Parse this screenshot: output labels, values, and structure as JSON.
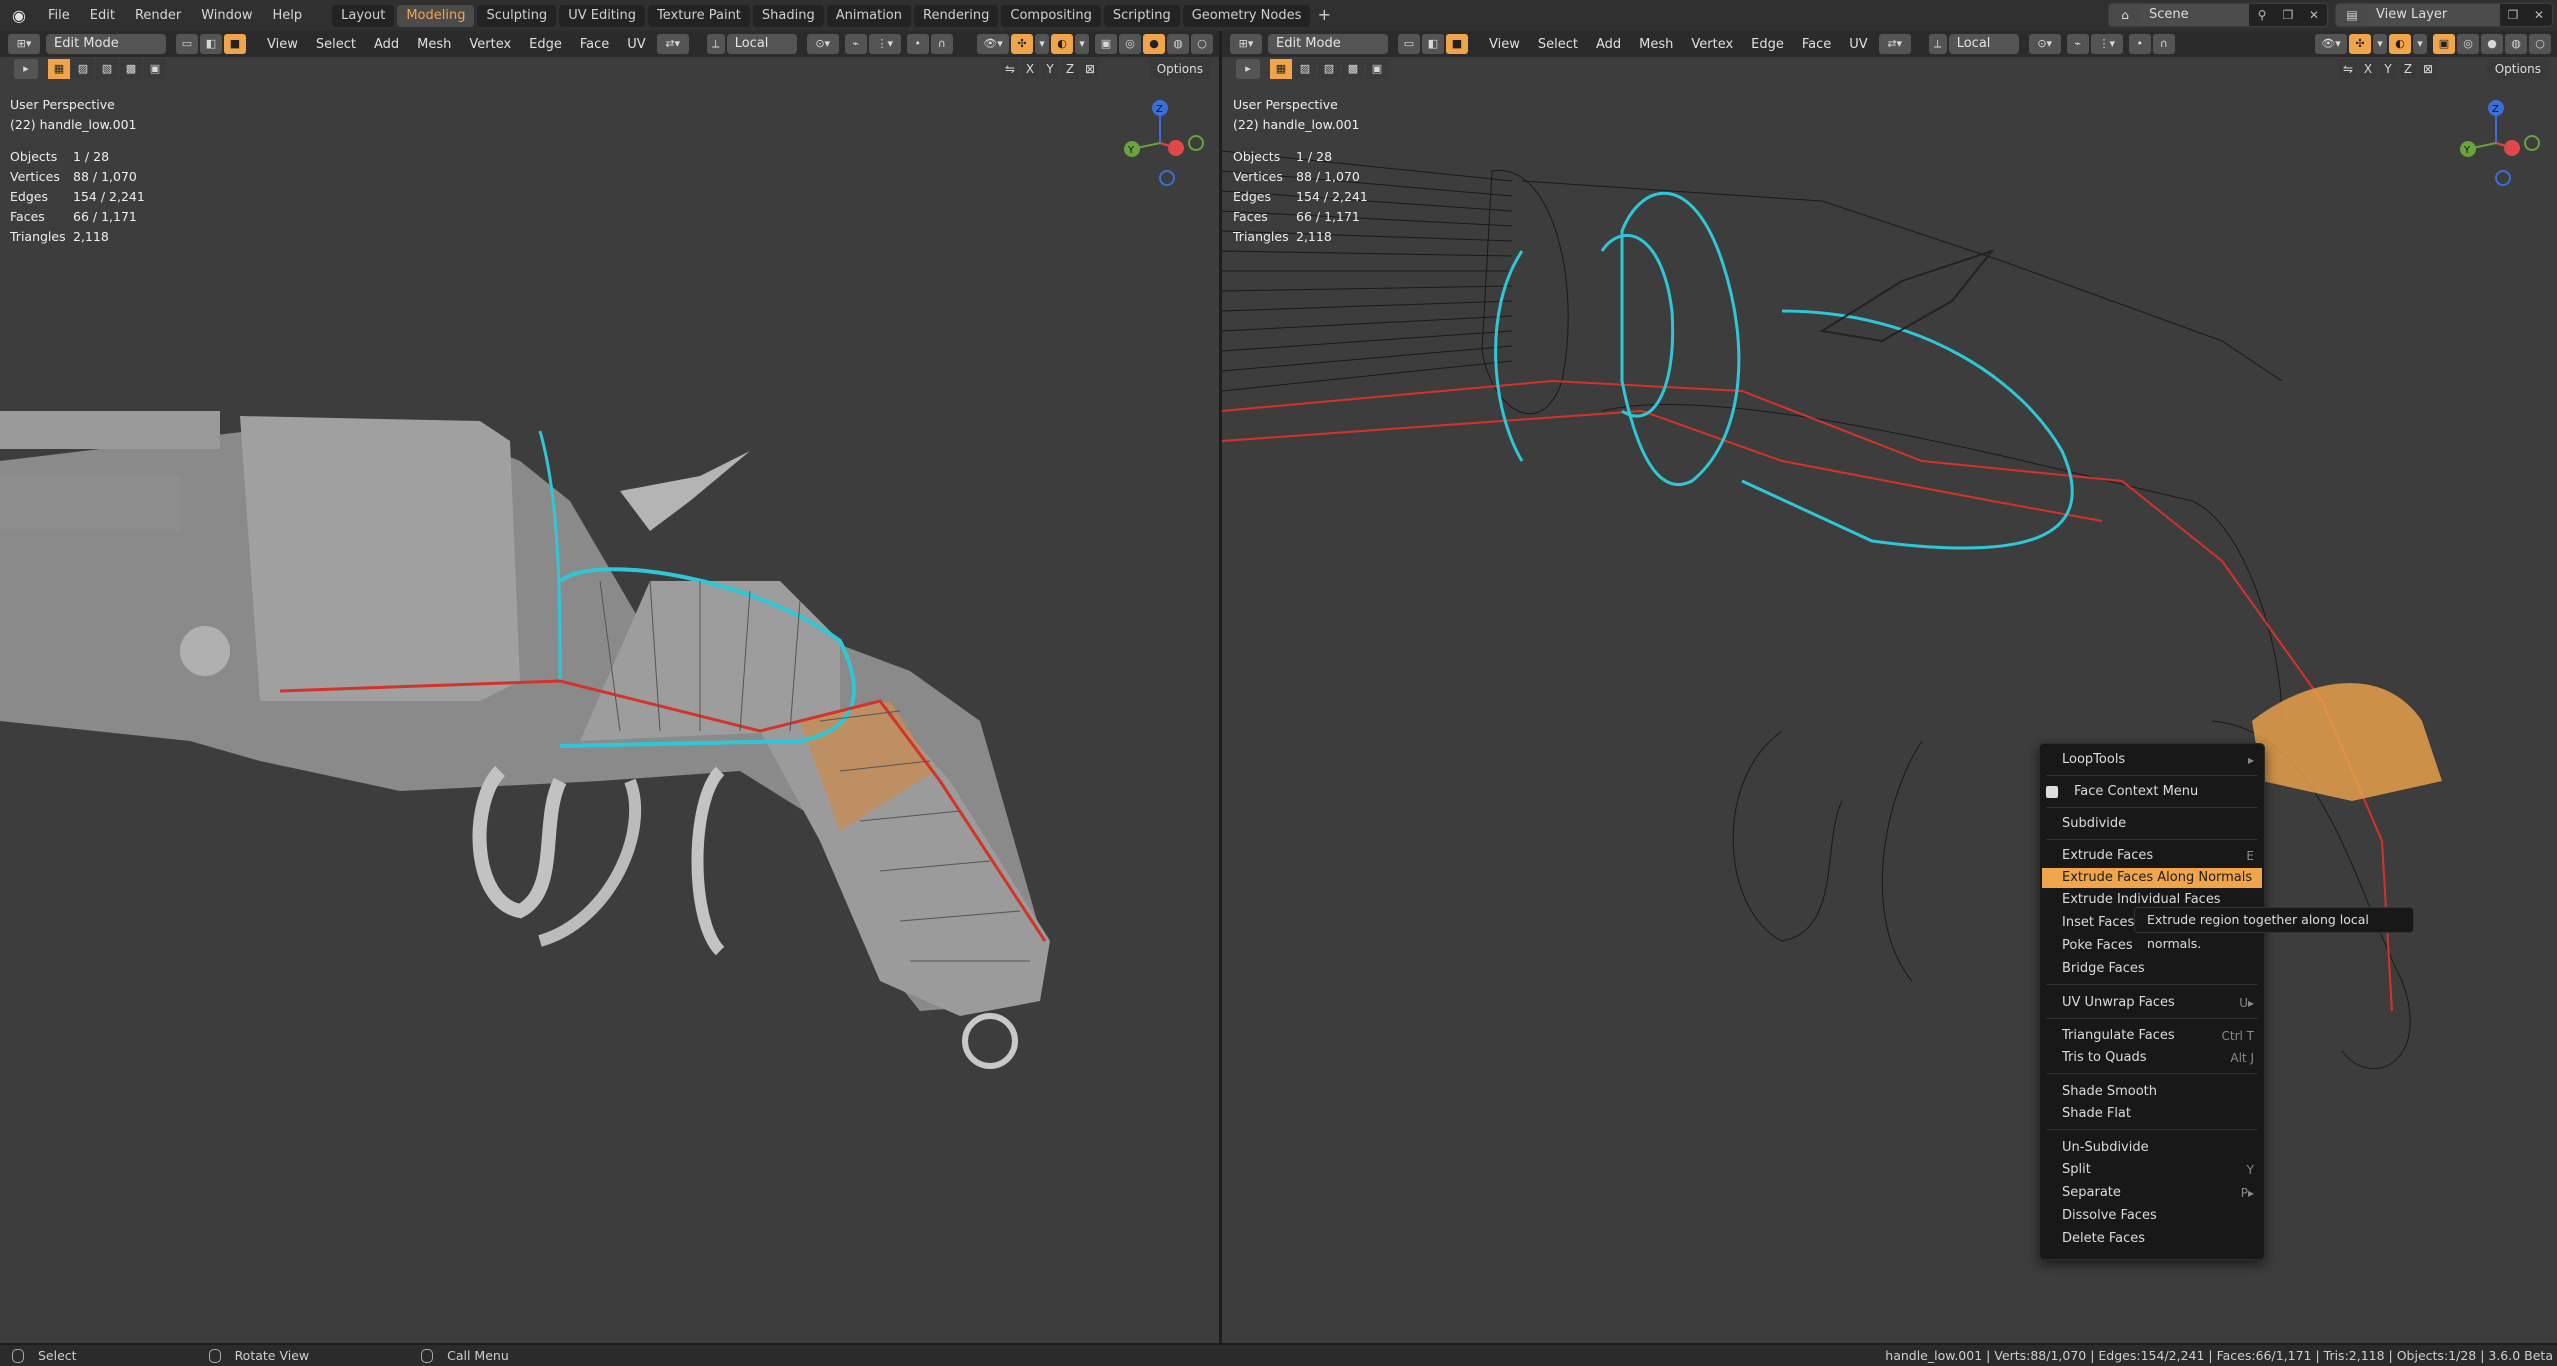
{
  "topbar": {
    "menu": [
      "File",
      "Edit",
      "Render",
      "Window",
      "Help"
    ],
    "workspaces": [
      "Layout",
      "Modeling",
      "Sculpting",
      "UV Editing",
      "Texture Paint",
      "Shading",
      "Animation",
      "Rendering",
      "Compositing",
      "Scripting",
      "Geometry Nodes"
    ],
    "active_workspace": "Modeling",
    "add_tab": "+",
    "scene": "Scene",
    "view_layer": "View Layer"
  },
  "viewport_left": {
    "mode": "Edit Mode",
    "menus": [
      "View",
      "Select",
      "Add",
      "Mesh",
      "Vertex",
      "Edge",
      "Face",
      "UV"
    ],
    "transform_orientation": "Local",
    "options": "Options",
    "axes": [
      "X",
      "Y",
      "Z"
    ],
    "view_name": "User Perspective",
    "object_name": "(22) handle_low.001",
    "stats": [
      {
        "label": "Objects",
        "value": "1 / 28"
      },
      {
        "label": "Vertices",
        "value": "88 / 1,070"
      },
      {
        "label": "Edges",
        "value": "154 / 2,241"
      },
      {
        "label": "Faces",
        "value": "66 / 1,171"
      },
      {
        "label": "Triangles",
        "value": "2,118"
      }
    ]
  },
  "viewport_right": {
    "mode": "Edit Mode",
    "menus": [
      "View",
      "Select",
      "Add",
      "Mesh",
      "Vertex",
      "Edge",
      "Face",
      "UV"
    ],
    "transform_orientation": "Local",
    "options": "Options",
    "axes": [
      "X",
      "Y",
      "Z"
    ],
    "view_name": "User Perspective",
    "object_name": "(22) handle_low.001",
    "stats": [
      {
        "label": "Objects",
        "value": "1 / 28"
      },
      {
        "label": "Vertices",
        "value": "88 / 1,070"
      },
      {
        "label": "Edges",
        "value": "154 / 2,241"
      },
      {
        "label": "Faces",
        "value": "66 / 1,171"
      },
      {
        "label": "Triangles",
        "value": "2,118"
      }
    ]
  },
  "gizmo": {
    "z": "Z",
    "y": "Y",
    "x_color": "#e0474a",
    "y_color": "#6aa33e",
    "z_color": "#3b6fd8"
  },
  "context_menu": {
    "title": "Face Context Menu",
    "items": [
      {
        "label": "LoopTools",
        "shortcut": "▸"
      },
      {
        "label": "Subdivide",
        "shortcut": ""
      },
      {
        "label": "Extrude Faces",
        "shortcut": "E"
      },
      {
        "label": "Extrude Faces Along Normals",
        "shortcut": ""
      },
      {
        "label": "Extrude Individual Faces",
        "shortcut": ""
      },
      {
        "label": "Inset Faces",
        "shortcut": ""
      },
      {
        "label": "Poke Faces",
        "shortcut": ""
      },
      {
        "label": "Bridge Faces",
        "shortcut": ""
      },
      {
        "label": "UV Unwrap Faces",
        "shortcut": "U▸"
      },
      {
        "label": "Triangulate Faces",
        "shortcut": "Ctrl T"
      },
      {
        "label": "Tris to Quads",
        "shortcut": "Alt J"
      },
      {
        "label": "Shade Smooth",
        "shortcut": ""
      },
      {
        "label": "Shade Flat",
        "shortcut": ""
      },
      {
        "label": "Un-Subdivide",
        "shortcut": ""
      },
      {
        "label": "Split",
        "shortcut": "Y"
      },
      {
        "label": "Separate",
        "shortcut": "P▸"
      },
      {
        "label": "Dissolve Faces",
        "shortcut": ""
      },
      {
        "label": "Delete Faces",
        "shortcut": ""
      }
    ],
    "highlighted": "Extrude Faces Along Normals",
    "tooltip": "Extrude region together along local normals."
  },
  "statusbar": {
    "select": "Select",
    "rotate": "Rotate View",
    "call_menu": "Call Menu",
    "info": "handle_low.001 | Verts:88/1,070 | Edges:154/2,241 | Faces:66/1,171 | Tris:2,118 | Objects:1/28 | 3.6.0 Beta"
  },
  "colors": {
    "accent": "#f0a54b",
    "selection_edge": "#2fc7d6",
    "seam": "#d3332a"
  }
}
